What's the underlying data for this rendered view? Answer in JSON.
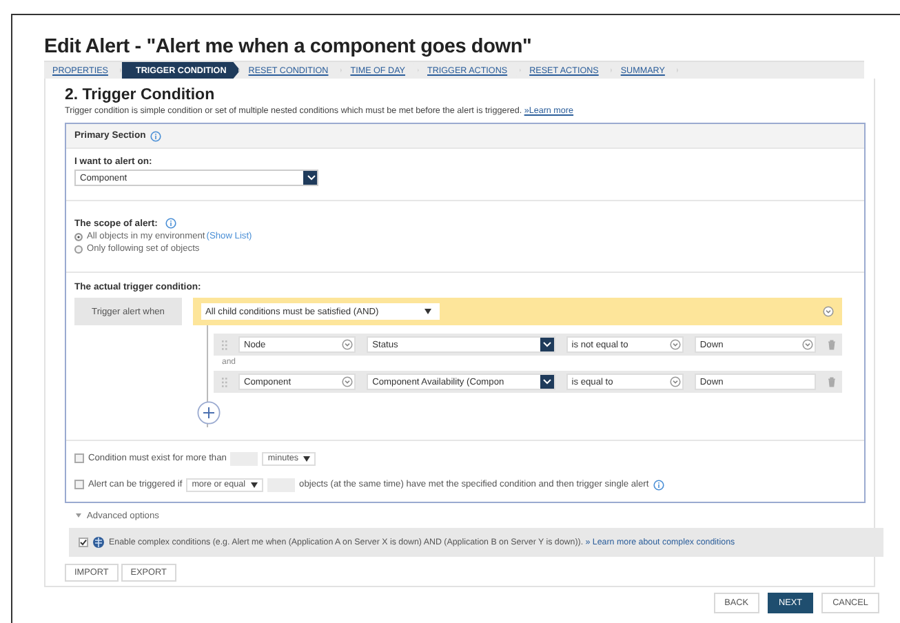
{
  "title": "Edit Alert - \"Alert me when a component goes down\"",
  "steps": [
    {
      "label": "PROPERTIES",
      "selected": false
    },
    {
      "label": "TRIGGER CONDITION",
      "selected": true
    },
    {
      "label": "RESET CONDITION",
      "selected": false
    },
    {
      "label": "TIME OF DAY",
      "selected": false
    },
    {
      "label": "TRIGGER ACTIONS",
      "selected": false
    },
    {
      "label": "RESET ACTIONS",
      "selected": false
    },
    {
      "label": "SUMMARY",
      "selected": false
    }
  ],
  "section": {
    "heading": "2. Trigger Condition",
    "description": "Trigger condition is simple condition or set of multiple nested conditions which must be met before the alert is triggered.",
    "learn_more": "»Learn more"
  },
  "primary": {
    "title": "Primary Section",
    "alert_on": {
      "label": "I want to alert on:",
      "value": "Component"
    },
    "scope": {
      "label": "The scope of alert:",
      "options": [
        {
          "label": "All objects in my environment",
          "link": "(Show List)",
          "selected": true
        },
        {
          "label": "Only following set of objects",
          "selected": false
        }
      ]
    },
    "trigger": {
      "label": "The actual trigger condition:",
      "when": "Trigger alert when",
      "mode": "All child conditions must be satisfied (AND)",
      "join": "and",
      "conditions": [
        {
          "object": "Node",
          "field": "Status",
          "operator": "is not equal to",
          "value": "Down",
          "kind": "dropdown"
        },
        {
          "object": "Component",
          "field": "Component Availability (Compon",
          "operator": "is equal to",
          "value": "Down",
          "kind": "text"
        }
      ]
    },
    "options": [
      {
        "kind": "duration",
        "checked": false,
        "label": "Condition must exist for more than",
        "unit": "minutes"
      },
      {
        "kind": "count",
        "checked": false,
        "label": "Alert can be triggered if",
        "comparison": "more or equal",
        "suffix": "objects (at the same time) have met the specified condition and then trigger single alert"
      }
    ]
  },
  "advanced": {
    "label": "Advanced options",
    "expanded": true,
    "complex": {
      "checked": true,
      "text": "Enable complex conditions (e.g. Alert me when (Application A on Server X is down) AND (Application B on Server Y is down)).",
      "link": "» Learn more about complex conditions"
    }
  },
  "io_buttons": [
    "IMPORT",
    "EXPORT"
  ],
  "nav_buttons": [
    {
      "label": "BACK",
      "kind": "secondary"
    },
    {
      "label": "NEXT",
      "kind": "primary"
    },
    {
      "label": "CANCEL",
      "kind": "secondary"
    }
  ]
}
